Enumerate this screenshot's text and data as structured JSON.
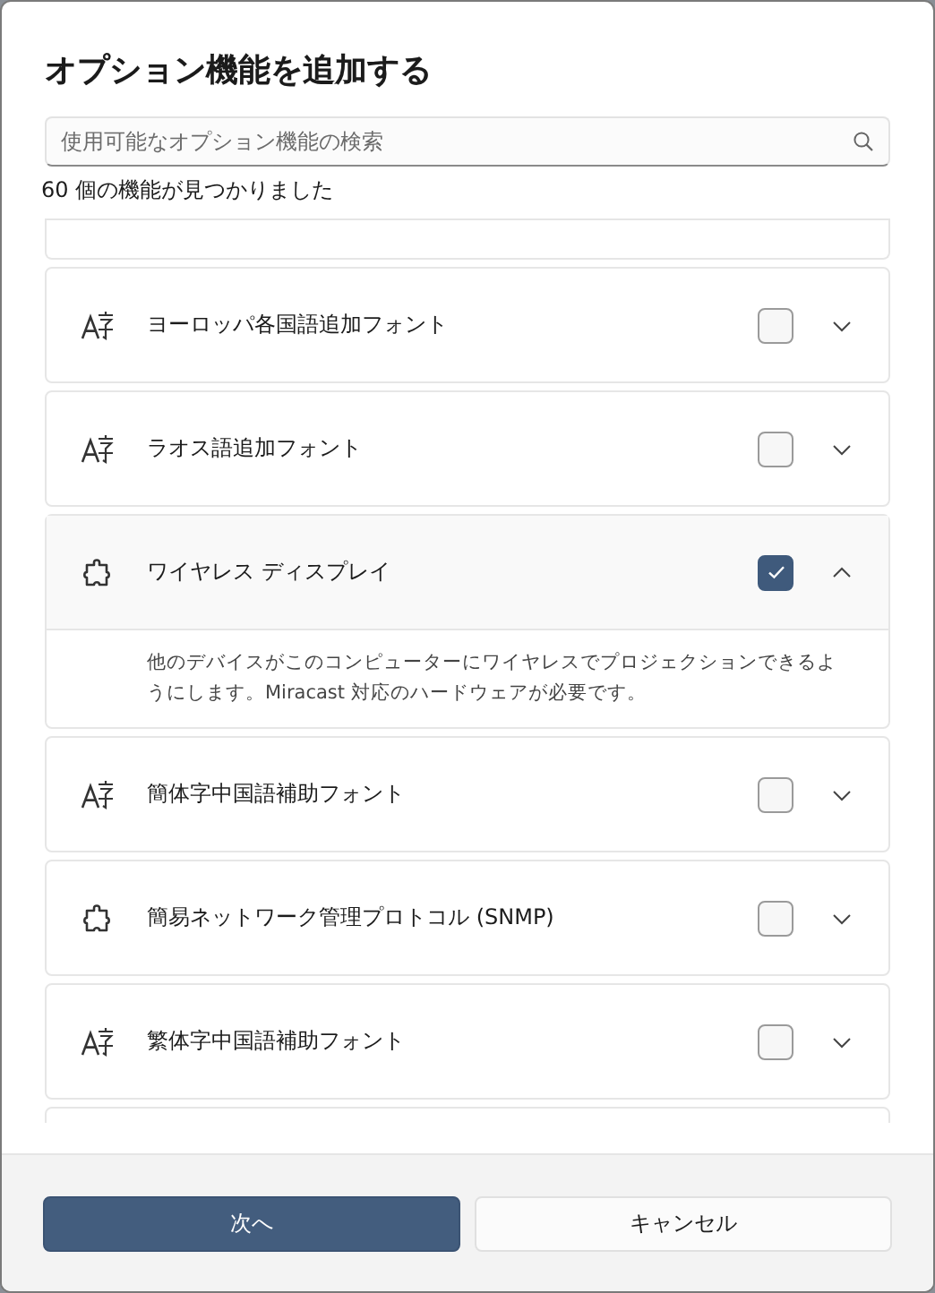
{
  "dialog": {
    "title": "オプション機能を追加する"
  },
  "search": {
    "placeholder": "使用可能なオプション機能の検索"
  },
  "result_count": "60 個の機能が見つかりました",
  "features": [
    {
      "kind": "font",
      "name": "ヨーロッパ各国語追加フォント",
      "checked": false,
      "expanded": false
    },
    {
      "kind": "font",
      "name": "ラオス語追加フォント",
      "checked": false,
      "expanded": false
    },
    {
      "kind": "puzzle",
      "name": "ワイヤレス ディスプレイ",
      "checked": true,
      "expanded": true,
      "description": "他のデバイスがこのコンピューターにワイヤレスでプロジェクションできるようにします。Miracast 対応のハードウェアが必要です。"
    },
    {
      "kind": "font",
      "name": "簡体字中国語補助フォント",
      "checked": false,
      "expanded": false
    },
    {
      "kind": "puzzle",
      "name": "簡易ネットワーク管理プロトコル (SNMP)",
      "checked": false,
      "expanded": false
    },
    {
      "kind": "font",
      "name": "繁体字中国語補助フォント",
      "checked": false,
      "expanded": false
    }
  ],
  "buttons": [
    {
      "label": "次へ",
      "kind": "primary"
    },
    {
      "label": "キャンセル",
      "kind": "secondary"
    }
  ]
}
